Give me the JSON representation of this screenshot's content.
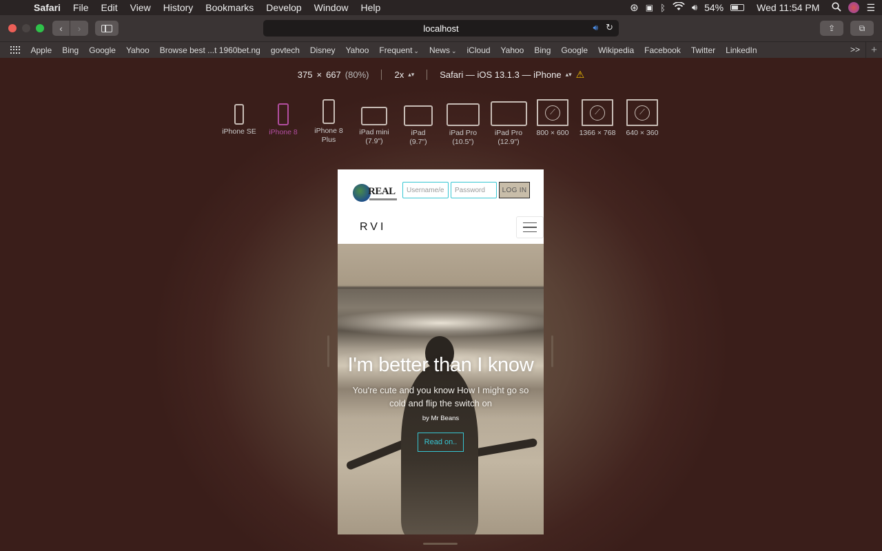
{
  "menubar": {
    "app": "Safari",
    "items": [
      "File",
      "Edit",
      "View",
      "History",
      "Bookmarks",
      "Develop",
      "Window",
      "Help"
    ],
    "battery": "54%",
    "clock": "Wed 11:54 PM"
  },
  "toolbar": {
    "url": "localhost"
  },
  "bookmarks": {
    "items": [
      "Apple",
      "Bing",
      "Google",
      "Yahoo",
      "Browse best ...t 1960bet.ng",
      "govtech",
      "Disney",
      "Yahoo",
      "Frequent",
      "News",
      "iCloud",
      "Yahoo",
      "Bing",
      "Google",
      "Wikipedia",
      "Facebook",
      "Twitter",
      "LinkedIn"
    ],
    "more": ">>"
  },
  "responsive": {
    "dim_w": "375",
    "dim_x": "×",
    "dim_h": "667",
    "scale": "(80%)",
    "pixel_ratio": "2x",
    "user_agent": "Safari — iOS 13.1.3 — iPhone"
  },
  "devices": [
    {
      "line1": "iPhone SE",
      "line2": ""
    },
    {
      "line1": "iPhone 8",
      "line2": ""
    },
    {
      "line1": "iPhone 8",
      "line2": "Plus"
    },
    {
      "line1": "iPad mini",
      "line2": "(7.9\")"
    },
    {
      "line1": "iPad",
      "line2": "(9.7\")"
    },
    {
      "line1": "iPad Pro",
      "line2": "(10.5\")"
    },
    {
      "line1": "iPad Pro",
      "line2": "(12.9\")"
    },
    {
      "line1": "800 × 600",
      "line2": ""
    },
    {
      "line1": "1366 × 768",
      "line2": ""
    },
    {
      "line1": "640 × 360",
      "line2": ""
    }
  ],
  "site": {
    "logo_text": "REAL",
    "username_placeholder": "Username/e",
    "password_placeholder": "Password",
    "login_label": "LOG IN",
    "brand": "RVI",
    "hero_title": "I'm better than I know",
    "hero_subtitle": "You're cute and you know How I might go so cold and flip the switch on",
    "hero_author": "by Mr Beans",
    "cta_label": "Read on.."
  },
  "colors": {
    "accent_cyan": "#36c6d3",
    "active_device": "#b24ea0",
    "warning": "#f5c400"
  }
}
